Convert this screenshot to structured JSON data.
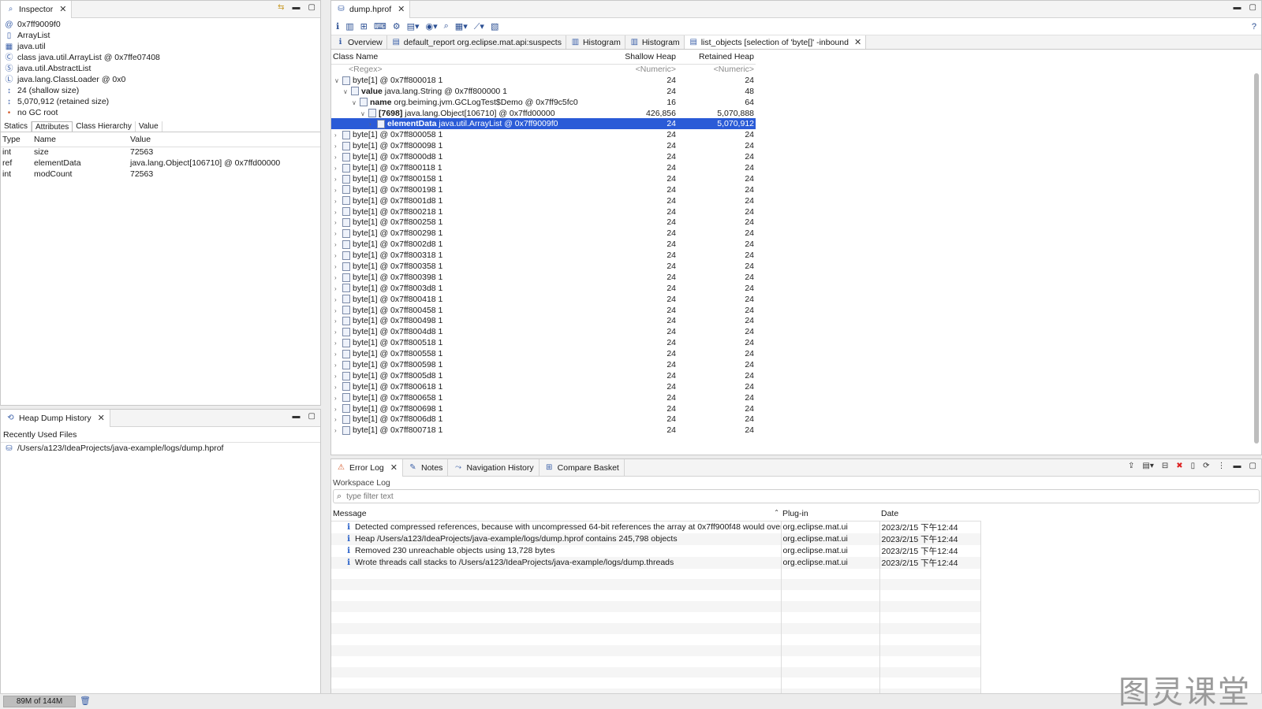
{
  "inspector": {
    "tab_title": "Inspector",
    "items": [
      {
        "icon": "at-icon",
        "text": "0x7ff9009f0"
      },
      {
        "icon": "file-icon",
        "text": "ArrayList"
      },
      {
        "icon": "package-icon",
        "text": "java.util"
      },
      {
        "icon": "class-icon",
        "text": "class java.util.ArrayList @ 0x7ffe07408"
      },
      {
        "icon": "superclass-icon",
        "text": "java.util.AbstractList"
      },
      {
        "icon": "classloader-icon",
        "text": "java.lang.ClassLoader @ 0x0"
      },
      {
        "icon": "size-icon",
        "text": "24 (shallow size)"
      },
      {
        "icon": "size-icon",
        "text": "5,070,912 (retained size)"
      },
      {
        "icon": "gc-icon",
        "text": "no GC root"
      }
    ],
    "subtabs": [
      "Statics",
      "Attributes",
      "Class Hierarchy",
      "Value"
    ],
    "active_subtab": "Attributes",
    "columns": [
      "Type",
      "Name",
      "Value"
    ],
    "rows": [
      [
        "int",
        "size",
        "72563"
      ],
      [
        "ref",
        "elementData",
        "java.lang.Object[106710] @ 0x7ffd00000"
      ],
      [
        "int",
        "modCount",
        "72563"
      ]
    ]
  },
  "history": {
    "tab_title": "Heap Dump History",
    "column": "Recently Used Files",
    "files": [
      "/Users/a123/IdeaProjects/java-example/logs/dump.hprof"
    ]
  },
  "editor": {
    "tab_title": "dump.hprof",
    "subtabs": [
      {
        "icon": "info-icon",
        "label": "Overview"
      },
      {
        "icon": "report-icon",
        "label": "default_report  org.eclipse.mat.api:suspects"
      },
      {
        "icon": "histogram-icon",
        "label": "Histogram"
      },
      {
        "icon": "histogram-icon",
        "label": "Histogram"
      },
      {
        "icon": "list-icon",
        "label": "list_objects  [selection of 'byte[]' -inbound"
      }
    ],
    "columns": [
      "Class Name",
      "Shallow Heap",
      "Retained Heap"
    ],
    "filter_row": [
      "<Regex>",
      "<Numeric>",
      "<Numeric>"
    ],
    "tree_rows": [
      {
        "indent": 0,
        "open": true,
        "bold": "",
        "text": "byte[1] @ 0x7ff800018  1",
        "shallow": "24",
        "retained": "24"
      },
      {
        "indent": 1,
        "open": true,
        "bold": "value",
        "text": " java.lang.String @ 0x7ff800000  1",
        "shallow": "24",
        "retained": "48"
      },
      {
        "indent": 2,
        "open": true,
        "bold": "name",
        "text": " org.beiming.jvm.GCLogTest$Demo @ 0x7ff9c5fc0",
        "shallow": "16",
        "retained": "64"
      },
      {
        "indent": 3,
        "open": true,
        "bold": "[7698]",
        "text": " java.lang.Object[106710] @ 0x7ffd00000",
        "shallow": "426,856",
        "retained": "5,070,888"
      },
      {
        "indent": 4,
        "open": false,
        "bold": "elementData",
        "text": "  java.util.ArrayList @ 0x7ff9009f0",
        "shallow": "24",
        "retained": "5,070,912",
        "selected": true
      },
      {
        "indent": 0,
        "open": false,
        "bold": "",
        "text": "byte[1] @ 0x7ff800058  1",
        "shallow": "24",
        "retained": "24"
      },
      {
        "indent": 0,
        "open": false,
        "bold": "",
        "text": "byte[1] @ 0x7ff800098  1",
        "shallow": "24",
        "retained": "24"
      },
      {
        "indent": 0,
        "open": false,
        "bold": "",
        "text": "byte[1] @ 0x7ff8000d8  1",
        "shallow": "24",
        "retained": "24"
      },
      {
        "indent": 0,
        "open": false,
        "bold": "",
        "text": "byte[1] @ 0x7ff800118  1",
        "shallow": "24",
        "retained": "24"
      },
      {
        "indent": 0,
        "open": false,
        "bold": "",
        "text": "byte[1] @ 0x7ff800158  1",
        "shallow": "24",
        "retained": "24"
      },
      {
        "indent": 0,
        "open": false,
        "bold": "",
        "text": "byte[1] @ 0x7ff800198  1",
        "shallow": "24",
        "retained": "24"
      },
      {
        "indent": 0,
        "open": false,
        "bold": "",
        "text": "byte[1] @ 0x7ff8001d8  1",
        "shallow": "24",
        "retained": "24"
      },
      {
        "indent": 0,
        "open": false,
        "bold": "",
        "text": "byte[1] @ 0x7ff800218  1",
        "shallow": "24",
        "retained": "24"
      },
      {
        "indent": 0,
        "open": false,
        "bold": "",
        "text": "byte[1] @ 0x7ff800258  1",
        "shallow": "24",
        "retained": "24"
      },
      {
        "indent": 0,
        "open": false,
        "bold": "",
        "text": "byte[1] @ 0x7ff800298  1",
        "shallow": "24",
        "retained": "24"
      },
      {
        "indent": 0,
        "open": false,
        "bold": "",
        "text": "byte[1] @ 0x7ff8002d8  1",
        "shallow": "24",
        "retained": "24"
      },
      {
        "indent": 0,
        "open": false,
        "bold": "",
        "text": "byte[1] @ 0x7ff800318  1",
        "shallow": "24",
        "retained": "24"
      },
      {
        "indent": 0,
        "open": false,
        "bold": "",
        "text": "byte[1] @ 0x7ff800358  1",
        "shallow": "24",
        "retained": "24"
      },
      {
        "indent": 0,
        "open": false,
        "bold": "",
        "text": "byte[1] @ 0x7ff800398  1",
        "shallow": "24",
        "retained": "24"
      },
      {
        "indent": 0,
        "open": false,
        "bold": "",
        "text": "byte[1] @ 0x7ff8003d8  1",
        "shallow": "24",
        "retained": "24"
      },
      {
        "indent": 0,
        "open": false,
        "bold": "",
        "text": "byte[1] @ 0x7ff800418  1",
        "shallow": "24",
        "retained": "24"
      },
      {
        "indent": 0,
        "open": false,
        "bold": "",
        "text": "byte[1] @ 0x7ff800458  1",
        "shallow": "24",
        "retained": "24"
      },
      {
        "indent": 0,
        "open": false,
        "bold": "",
        "text": "byte[1] @ 0x7ff800498  1",
        "shallow": "24",
        "retained": "24"
      },
      {
        "indent": 0,
        "open": false,
        "bold": "",
        "text": "byte[1] @ 0x7ff8004d8  1",
        "shallow": "24",
        "retained": "24"
      },
      {
        "indent": 0,
        "open": false,
        "bold": "",
        "text": "byte[1] @ 0x7ff800518  1",
        "shallow": "24",
        "retained": "24"
      },
      {
        "indent": 0,
        "open": false,
        "bold": "",
        "text": "byte[1] @ 0x7ff800558  1",
        "shallow": "24",
        "retained": "24"
      },
      {
        "indent": 0,
        "open": false,
        "bold": "",
        "text": "byte[1] @ 0x7ff800598  1",
        "shallow": "24",
        "retained": "24"
      },
      {
        "indent": 0,
        "open": false,
        "bold": "",
        "text": "byte[1] @ 0x7ff8005d8  1",
        "shallow": "24",
        "retained": "24"
      },
      {
        "indent": 0,
        "open": false,
        "bold": "",
        "text": "byte[1] @ 0x7ff800618  1",
        "shallow": "24",
        "retained": "24"
      },
      {
        "indent": 0,
        "open": false,
        "bold": "",
        "text": "byte[1] @ 0x7ff800658  1",
        "shallow": "24",
        "retained": "24"
      },
      {
        "indent": 0,
        "open": false,
        "bold": "",
        "text": "byte[1] @ 0x7ff800698  1",
        "shallow": "24",
        "retained": "24"
      },
      {
        "indent": 0,
        "open": false,
        "bold": "",
        "text": "byte[1] @ 0x7ff8006d8  1",
        "shallow": "24",
        "retained": "24"
      },
      {
        "indent": 0,
        "open": false,
        "bold": "",
        "text": "byte[1] @ 0x7ff800718  1",
        "shallow": "24",
        "retained": "24"
      }
    ]
  },
  "bottom": {
    "tabs": [
      {
        "icon": "error-log-icon",
        "label": "Error Log",
        "closable": true
      },
      {
        "icon": "notes-icon",
        "label": "Notes",
        "closable": false
      },
      {
        "icon": "navigation-icon",
        "label": "Navigation History",
        "closable": false
      },
      {
        "icon": "basket-icon",
        "label": "Compare Basket",
        "closable": false
      }
    ],
    "workspace_label": "Workspace Log",
    "filter_placeholder": "type filter text",
    "columns": [
      "Message",
      "Plug-in",
      "Date"
    ],
    "rows": [
      [
        "Detected compressed references, because with uncompressed 64-bit references the array at 0x7ff900f48 would overlap t",
        "org.eclipse.mat.ui",
        "2023/2/15 下午12:44"
      ],
      [
        "Heap /Users/a123/IdeaProjects/java-example/logs/dump.hprof contains 245,798 objects",
        "org.eclipse.mat.ui",
        "2023/2/15 下午12:44"
      ],
      [
        "Removed 230 unreachable objects using 13,728 bytes",
        "org.eclipse.mat.ui",
        "2023/2/15 下午12:44"
      ],
      [
        "Wrote threads call stacks to /Users/a123/IdeaProjects/java-example/logs/dump.threads",
        "org.eclipse.mat.ui",
        "2023/2/15 下午12:44"
      ]
    ]
  },
  "status": {
    "memory": "89M of 144M"
  },
  "watermark": "图灵课堂",
  "colors": {
    "selection": "#2a5bd7",
    "accent": "#3a5fa8",
    "info": "#2b62c9"
  }
}
